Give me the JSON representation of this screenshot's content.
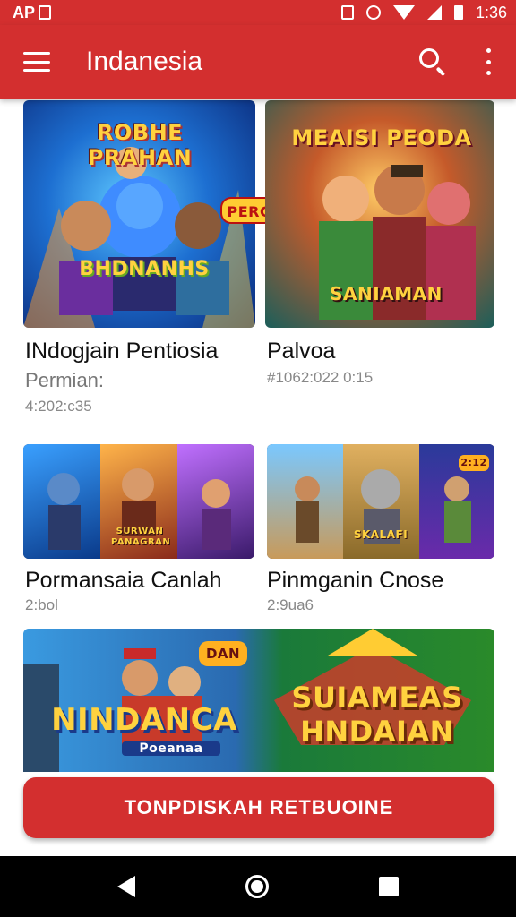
{
  "status_bar": {
    "left_text": "AP",
    "time": "1:36",
    "icons": [
      "notification-box-icon",
      "alarm-icon",
      "wifi-icon",
      "signal-icon",
      "battery-icon"
    ]
  },
  "app_bar": {
    "title": "Indanesia",
    "icons": [
      "menu-icon",
      "search-icon",
      "more-vert-icon"
    ]
  },
  "cards": [
    {
      "art_top": "ROBHE PRAHAN",
      "art_mid": "PERGULA?",
      "art_bottom": "BHDNANHS",
      "title": "INdogjain Pentiosia",
      "subtitle": "Permian:",
      "meta": "4:202:c35"
    },
    {
      "art_top": "MEAISI PEODA",
      "art_bottom": "SANIAMAN",
      "title": "Palvoa",
      "meta": "#1062:022 0:15"
    },
    {
      "art_caption": "SURWAN PANAGRAN",
      "title": "Pormansaia Canlah",
      "meta": "2:bol"
    },
    {
      "art_caption": "SKALAFI",
      "art_badge": "2:12",
      "title": "Pinmganin Cnose",
      "meta": "2:9ua6"
    }
  ],
  "banner": {
    "left_text": "NINDANCA",
    "left_sub": "Poeanaa",
    "badge": "DAN",
    "right_line1": "SUIAMEAS",
    "right_line2": "HNDAIAN"
  },
  "cta_label": "TONPDISKAH RETBUOINE",
  "colors": {
    "primary": "#d32f2f",
    "nav": "#000000"
  }
}
